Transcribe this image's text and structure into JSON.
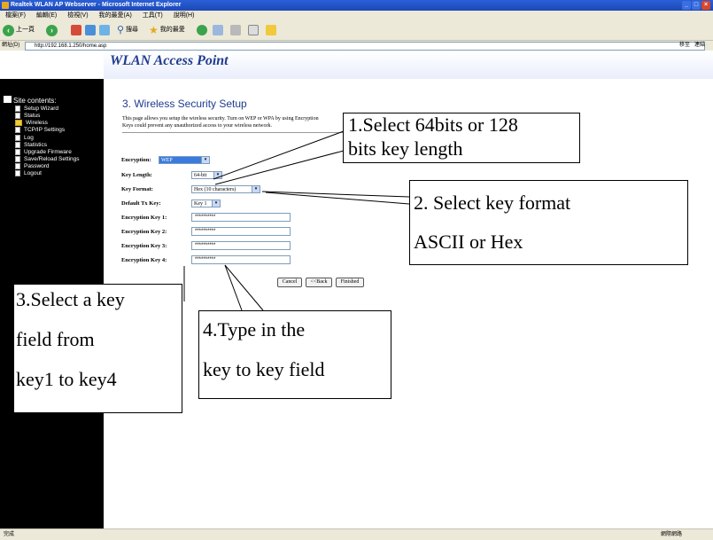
{
  "browser": {
    "window_title": "Realtek WLAN AP Webserver - Microsoft Internet Explorer",
    "menu": [
      "檔案(F)",
      "編輯(E)",
      "檢視(V)",
      "我的最愛(A)",
      "工具(T)",
      "說明(H)"
    ],
    "back_label": "上一頁",
    "search_label": "搜尋",
    "favorites_label": "我的最愛",
    "address_label": "網址(D)",
    "address_value": "http://192.168.1.250/home.asp",
    "go_label": "移至",
    "links_label": "連結",
    "status_left": "完成",
    "status_right": "網際網路"
  },
  "banner": {
    "title": "WLAN Access Point"
  },
  "sidebar": {
    "heading": "Site contents:",
    "items": [
      {
        "label": "Setup Wizard",
        "type": "doc"
      },
      {
        "label": "Status",
        "type": "doc"
      },
      {
        "label": "Wireless",
        "type": "folder"
      },
      {
        "label": "TCP/IP Settings",
        "type": "doc"
      },
      {
        "label": "Log",
        "type": "doc"
      },
      {
        "label": "Statistics",
        "type": "doc"
      },
      {
        "label": "Upgrade Firmware",
        "type": "doc"
      },
      {
        "label": "Save/Reload Settings",
        "type": "doc"
      },
      {
        "label": "Password",
        "type": "doc"
      },
      {
        "label": "Logout",
        "type": "doc"
      }
    ]
  },
  "page": {
    "title": "3. Wireless Security Setup",
    "description": "This page allows you setup the wireless security. Turn on WEP or WPA by using Encryption Keys could prevent any unauthorized access to your wireless network.",
    "encryption_label": "Encryption:",
    "encryption_value": "WEP",
    "key_length_label": "Key Length:",
    "key_length_value": "64-bit",
    "key_format_label": "Key Format:",
    "key_format_value": "Hex (10 characters)",
    "default_tx_key_label": "Default Tx Key:",
    "default_tx_key_value": "Key 1",
    "key_labels": [
      "Encryption Key 1:",
      "Encryption Key 2:",
      "Encryption Key 3:",
      "Encryption Key 4:"
    ],
    "key_values": [
      "**********",
      "**********",
      "**********",
      "**********"
    ],
    "cancel_label": "Cancel",
    "back_label": "<<Back",
    "finished_label": "Finished"
  },
  "callouts": {
    "c1_line1": "1.Select 64bits or 128",
    "c1_line2": "bits key length",
    "c2_line1": "2. Select key format",
    "c2_line2": "ASCII or Hex",
    "c3_line1": "3.Select a key",
    "c3_line2": "field from",
    "c3_line3": "key1 to key4",
    "c4_line1": "4.Type in the",
    "c4_line2": "key to key field"
  },
  "colors": {
    "banner_text": "#1f3c8f",
    "sidebar_bg": "#000000",
    "title_bar": "#2a5fd6"
  }
}
